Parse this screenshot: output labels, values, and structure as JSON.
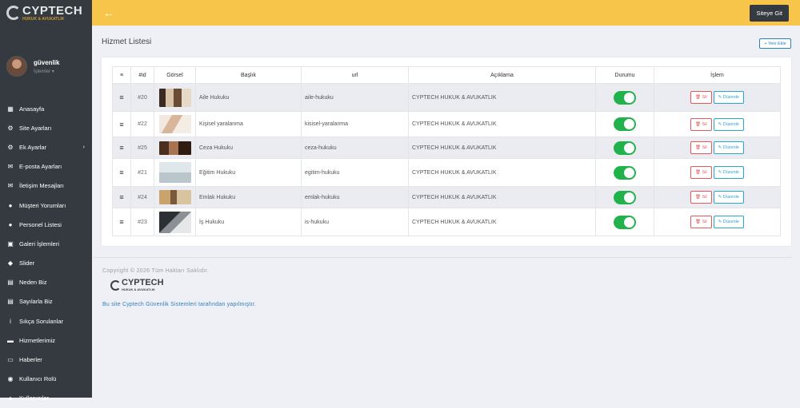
{
  "brand": {
    "logo_big": "CYPTECH",
    "logo_small": "HUKUK & AVUKATLIK"
  },
  "user": {
    "name": "güvenlik",
    "role": "İşlemler"
  },
  "sidebar": {
    "items": [
      {
        "label": "Anasayfa",
        "icon": "dashboard-icon"
      },
      {
        "label": "Site Ayarları",
        "icon": "gear-icon"
      },
      {
        "label": "Ek Ayarlar",
        "icon": "gear-icon",
        "caret": "›"
      },
      {
        "label": "E-posta Ayarları",
        "icon": "envelope-icon"
      },
      {
        "label": "İletişim Mesajları",
        "icon": "envelope-icon"
      },
      {
        "label": "Müşteri Yorumları",
        "icon": "comments-icon"
      },
      {
        "label": "Personel Listesi",
        "icon": "users-icon"
      },
      {
        "label": "Galeri İşlemleri",
        "icon": "gallery-icon"
      },
      {
        "label": "Slider",
        "icon": "sliders-icon"
      },
      {
        "label": "Neden Biz",
        "icon": "database-icon"
      },
      {
        "label": "Sayılarla Biz",
        "icon": "database-icon"
      },
      {
        "label": "Sıkça Sorulanlar",
        "icon": "info-icon"
      },
      {
        "label": "Hizmetlerimiz",
        "icon": "briefcase-icon"
      },
      {
        "label": "Haberler",
        "icon": "newspaper-icon"
      },
      {
        "label": "Kullanıcı Rolü",
        "icon": "eye-icon"
      },
      {
        "label": "Kullanıcılar",
        "icon": "lock-icon"
      }
    ]
  },
  "topbar": {
    "back": "←",
    "site_button": "Siteye Git"
  },
  "page": {
    "title": "Hizmet Listesi",
    "new_button": "+ Yeni Ekle"
  },
  "table": {
    "headers": {
      "handle": "≡",
      "id": "#id",
      "image": "Görsel",
      "title": "Başlık",
      "url": "url",
      "description": "Açıklama",
      "status": "Durumu",
      "action": "İşlem"
    },
    "rows": [
      {
        "handle": "≡",
        "id": "#20",
        "title": "Aile Hukuku",
        "url": "aile-hukuku",
        "description": "CYPTECH HUKUK & AVUKATLIK",
        "active": true,
        "delete": "🗑 Sil",
        "edit": "✎ Düzenle"
      },
      {
        "handle": "≡",
        "id": "#22",
        "title": "Kişisel yaralanma",
        "url": "kisisel-yaralanma",
        "description": "CYPTECH HUKUK & AVUKATLIK",
        "active": true,
        "delete": "🗑 Sil",
        "edit": "✎ Düzenle"
      },
      {
        "handle": "≡",
        "id": "#25",
        "title": "Ceza Hukuku",
        "url": "ceza-hukuku",
        "description": "CYPTECH HUKUK & AVUKATLIK",
        "active": true,
        "delete": "🗑 Sil",
        "edit": "✎ Düzenle"
      },
      {
        "handle": "≡",
        "id": "#21",
        "title": "Eğitim Hukuku",
        "url": "egitim-hukuku",
        "description": "CYPTECH HUKUK & AVUKATLIK",
        "active": true,
        "delete": "🗑 Sil",
        "edit": "✎ Düzenle"
      },
      {
        "handle": "≡",
        "id": "#24",
        "title": "Emlak Hukuku",
        "url": "emlak-hukuku",
        "description": "CYPTECH HUKUK & AVUKATLIK",
        "active": true,
        "delete": "🗑 Sil",
        "edit": "✎ Düzenle"
      },
      {
        "handle": "≡",
        "id": "#23",
        "title": "İş Hukuku",
        "url": "is-hukuku",
        "description": "CYPTECH HUKUK & AVUKATLIK",
        "active": true,
        "delete": "🗑 Sil",
        "edit": "✎ Düzenle"
      }
    ]
  },
  "footer": {
    "copyright": "Copyright © 2026 Tüm Hakları Saklıdır.",
    "logo_big": "CYPTECH",
    "logo_small": "HUKUK & AVUKATLIK",
    "made_by": "Bu site Cyptech Güvenlik Sistemleri tarafından yapılmıştır."
  }
}
